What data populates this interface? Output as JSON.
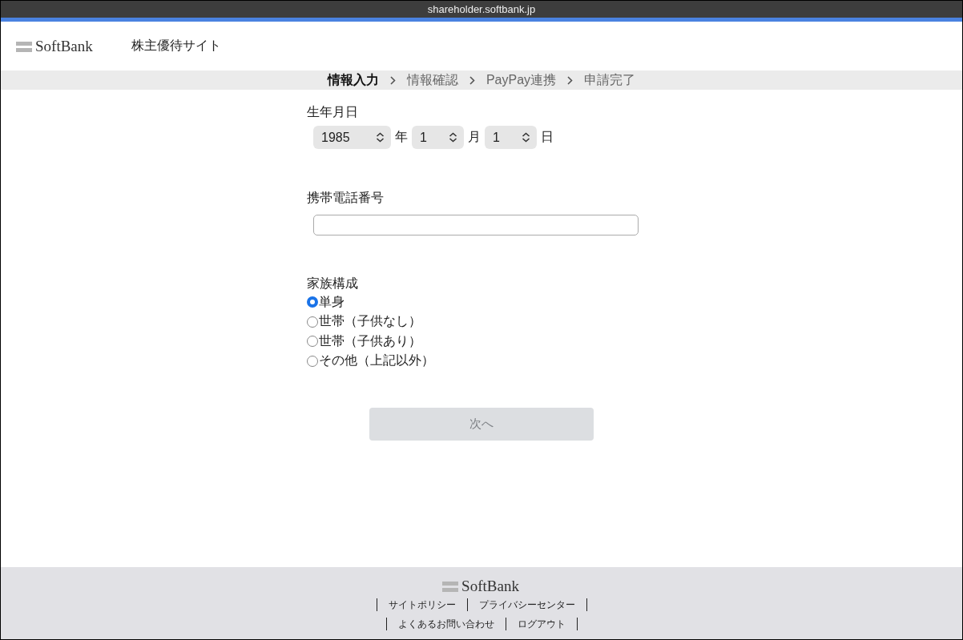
{
  "browser": {
    "url": "shareholder.softbank.jp"
  },
  "header": {
    "logo": "SoftBank",
    "site_title": "株主優待サイト"
  },
  "steps": [
    {
      "label": "情報入力",
      "selected": true
    },
    {
      "label": "情報確認",
      "selected": false
    },
    {
      "label": "PayPay連携",
      "selected": false
    },
    {
      "label": "申請完了",
      "selected": false
    }
  ],
  "birthdate": {
    "label": "生年月日",
    "fields": [
      {
        "value": "1985",
        "unit": "年"
      },
      {
        "value": "1",
        "unit": "月"
      },
      {
        "value": "1",
        "unit": "日"
      }
    ]
  },
  "phone": {
    "label": "携帯電話番号"
  },
  "family": {
    "label": "家族構成",
    "options": [
      {
        "label": "単身",
        "selected": true
      },
      {
        "label": "世帯（子供なし）",
        "selected": false
      },
      {
        "label": "世帯（子供あり）",
        "selected": false
      },
      {
        "label": "その他（上記以外）",
        "selected": false
      }
    ]
  },
  "next_button": {
    "label": "次へ",
    "disabled": true
  },
  "footer": {
    "logo": "SoftBank",
    "link_rows": [
      {
        "links": [
          "サイトポリシー",
          "プライバシーセンター"
        ]
      },
      {
        "links": [
          "よくあるお問い合わせ",
          "ログアウト"
        ]
      }
    ]
  }
}
